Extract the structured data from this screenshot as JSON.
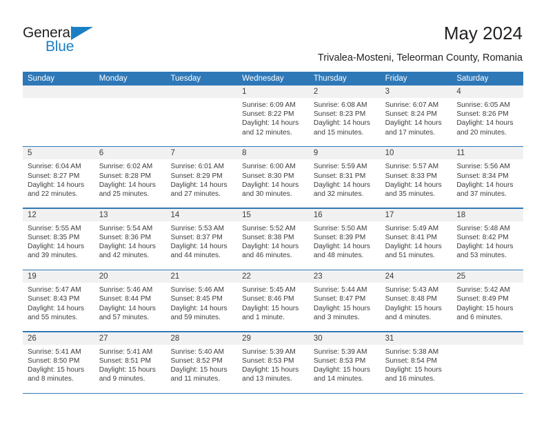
{
  "brand": {
    "name_top": "General",
    "name_bottom": "Blue",
    "triangle_color": "#1b7fc4",
    "text_color": "#231f20"
  },
  "header": {
    "title": "May 2024",
    "subtitle": "Trivalea-Mosteni, Teleorman County, Romania"
  },
  "theme": {
    "header_blue": "#2e78b8",
    "number_band": "#f1f1f1",
    "rule_blue": "#2e78b8",
    "text": "#3b3b3b"
  },
  "calendar": {
    "weekday_headers": [
      "Sunday",
      "Monday",
      "Tuesday",
      "Wednesday",
      "Thursday",
      "Friday",
      "Saturday"
    ],
    "weeks": [
      [
        {
          "day": "",
          "sunrise": "",
          "sunset": "",
          "daylight_1": "",
          "daylight_2": ""
        },
        {
          "day": "",
          "sunrise": "",
          "sunset": "",
          "daylight_1": "",
          "daylight_2": ""
        },
        {
          "day": "",
          "sunrise": "",
          "sunset": "",
          "daylight_1": "",
          "daylight_2": ""
        },
        {
          "day": "1",
          "sunrise": "Sunrise: 6:09 AM",
          "sunset": "Sunset: 8:22 PM",
          "daylight_1": "Daylight: 14 hours",
          "daylight_2": "and 12 minutes."
        },
        {
          "day": "2",
          "sunrise": "Sunrise: 6:08 AM",
          "sunset": "Sunset: 8:23 PM",
          "daylight_1": "Daylight: 14 hours",
          "daylight_2": "and 15 minutes."
        },
        {
          "day": "3",
          "sunrise": "Sunrise: 6:07 AM",
          "sunset": "Sunset: 8:24 PM",
          "daylight_1": "Daylight: 14 hours",
          "daylight_2": "and 17 minutes."
        },
        {
          "day": "4",
          "sunrise": "Sunrise: 6:05 AM",
          "sunset": "Sunset: 8:26 PM",
          "daylight_1": "Daylight: 14 hours",
          "daylight_2": "and 20 minutes."
        }
      ],
      [
        {
          "day": "5",
          "sunrise": "Sunrise: 6:04 AM",
          "sunset": "Sunset: 8:27 PM",
          "daylight_1": "Daylight: 14 hours",
          "daylight_2": "and 22 minutes."
        },
        {
          "day": "6",
          "sunrise": "Sunrise: 6:02 AM",
          "sunset": "Sunset: 8:28 PM",
          "daylight_1": "Daylight: 14 hours",
          "daylight_2": "and 25 minutes."
        },
        {
          "day": "7",
          "sunrise": "Sunrise: 6:01 AM",
          "sunset": "Sunset: 8:29 PM",
          "daylight_1": "Daylight: 14 hours",
          "daylight_2": "and 27 minutes."
        },
        {
          "day": "8",
          "sunrise": "Sunrise: 6:00 AM",
          "sunset": "Sunset: 8:30 PM",
          "daylight_1": "Daylight: 14 hours",
          "daylight_2": "and 30 minutes."
        },
        {
          "day": "9",
          "sunrise": "Sunrise: 5:59 AM",
          "sunset": "Sunset: 8:31 PM",
          "daylight_1": "Daylight: 14 hours",
          "daylight_2": "and 32 minutes."
        },
        {
          "day": "10",
          "sunrise": "Sunrise: 5:57 AM",
          "sunset": "Sunset: 8:33 PM",
          "daylight_1": "Daylight: 14 hours",
          "daylight_2": "and 35 minutes."
        },
        {
          "day": "11",
          "sunrise": "Sunrise: 5:56 AM",
          "sunset": "Sunset: 8:34 PM",
          "daylight_1": "Daylight: 14 hours",
          "daylight_2": "and 37 minutes."
        }
      ],
      [
        {
          "day": "12",
          "sunrise": "Sunrise: 5:55 AM",
          "sunset": "Sunset: 8:35 PM",
          "daylight_1": "Daylight: 14 hours",
          "daylight_2": "and 39 minutes."
        },
        {
          "day": "13",
          "sunrise": "Sunrise: 5:54 AM",
          "sunset": "Sunset: 8:36 PM",
          "daylight_1": "Daylight: 14 hours",
          "daylight_2": "and 42 minutes."
        },
        {
          "day": "14",
          "sunrise": "Sunrise: 5:53 AM",
          "sunset": "Sunset: 8:37 PM",
          "daylight_1": "Daylight: 14 hours",
          "daylight_2": "and 44 minutes."
        },
        {
          "day": "15",
          "sunrise": "Sunrise: 5:52 AM",
          "sunset": "Sunset: 8:38 PM",
          "daylight_1": "Daylight: 14 hours",
          "daylight_2": "and 46 minutes."
        },
        {
          "day": "16",
          "sunrise": "Sunrise: 5:50 AM",
          "sunset": "Sunset: 8:39 PM",
          "daylight_1": "Daylight: 14 hours",
          "daylight_2": "and 48 minutes."
        },
        {
          "day": "17",
          "sunrise": "Sunrise: 5:49 AM",
          "sunset": "Sunset: 8:41 PM",
          "daylight_1": "Daylight: 14 hours",
          "daylight_2": "and 51 minutes."
        },
        {
          "day": "18",
          "sunrise": "Sunrise: 5:48 AM",
          "sunset": "Sunset: 8:42 PM",
          "daylight_1": "Daylight: 14 hours",
          "daylight_2": "and 53 minutes."
        }
      ],
      [
        {
          "day": "19",
          "sunrise": "Sunrise: 5:47 AM",
          "sunset": "Sunset: 8:43 PM",
          "daylight_1": "Daylight: 14 hours",
          "daylight_2": "and 55 minutes."
        },
        {
          "day": "20",
          "sunrise": "Sunrise: 5:46 AM",
          "sunset": "Sunset: 8:44 PM",
          "daylight_1": "Daylight: 14 hours",
          "daylight_2": "and 57 minutes."
        },
        {
          "day": "21",
          "sunrise": "Sunrise: 5:46 AM",
          "sunset": "Sunset: 8:45 PM",
          "daylight_1": "Daylight: 14 hours",
          "daylight_2": "and 59 minutes."
        },
        {
          "day": "22",
          "sunrise": "Sunrise: 5:45 AM",
          "sunset": "Sunset: 8:46 PM",
          "daylight_1": "Daylight: 15 hours",
          "daylight_2": "and 1 minute."
        },
        {
          "day": "23",
          "sunrise": "Sunrise: 5:44 AM",
          "sunset": "Sunset: 8:47 PM",
          "daylight_1": "Daylight: 15 hours",
          "daylight_2": "and 3 minutes."
        },
        {
          "day": "24",
          "sunrise": "Sunrise: 5:43 AM",
          "sunset": "Sunset: 8:48 PM",
          "daylight_1": "Daylight: 15 hours",
          "daylight_2": "and 4 minutes."
        },
        {
          "day": "25",
          "sunrise": "Sunrise: 5:42 AM",
          "sunset": "Sunset: 8:49 PM",
          "daylight_1": "Daylight: 15 hours",
          "daylight_2": "and 6 minutes."
        }
      ],
      [
        {
          "day": "26",
          "sunrise": "Sunrise: 5:41 AM",
          "sunset": "Sunset: 8:50 PM",
          "daylight_1": "Daylight: 15 hours",
          "daylight_2": "and 8 minutes."
        },
        {
          "day": "27",
          "sunrise": "Sunrise: 5:41 AM",
          "sunset": "Sunset: 8:51 PM",
          "daylight_1": "Daylight: 15 hours",
          "daylight_2": "and 9 minutes."
        },
        {
          "day": "28",
          "sunrise": "Sunrise: 5:40 AM",
          "sunset": "Sunset: 8:52 PM",
          "daylight_1": "Daylight: 15 hours",
          "daylight_2": "and 11 minutes."
        },
        {
          "day": "29",
          "sunrise": "Sunrise: 5:39 AM",
          "sunset": "Sunset: 8:53 PM",
          "daylight_1": "Daylight: 15 hours",
          "daylight_2": "and 13 minutes."
        },
        {
          "day": "30",
          "sunrise": "Sunrise: 5:39 AM",
          "sunset": "Sunset: 8:53 PM",
          "daylight_1": "Daylight: 15 hours",
          "daylight_2": "and 14 minutes."
        },
        {
          "day": "31",
          "sunrise": "Sunrise: 5:38 AM",
          "sunset": "Sunset: 8:54 PM",
          "daylight_1": "Daylight: 15 hours",
          "daylight_2": "and 16 minutes."
        },
        {
          "day": "",
          "sunrise": "",
          "sunset": "",
          "daylight_1": "",
          "daylight_2": ""
        }
      ]
    ]
  }
}
